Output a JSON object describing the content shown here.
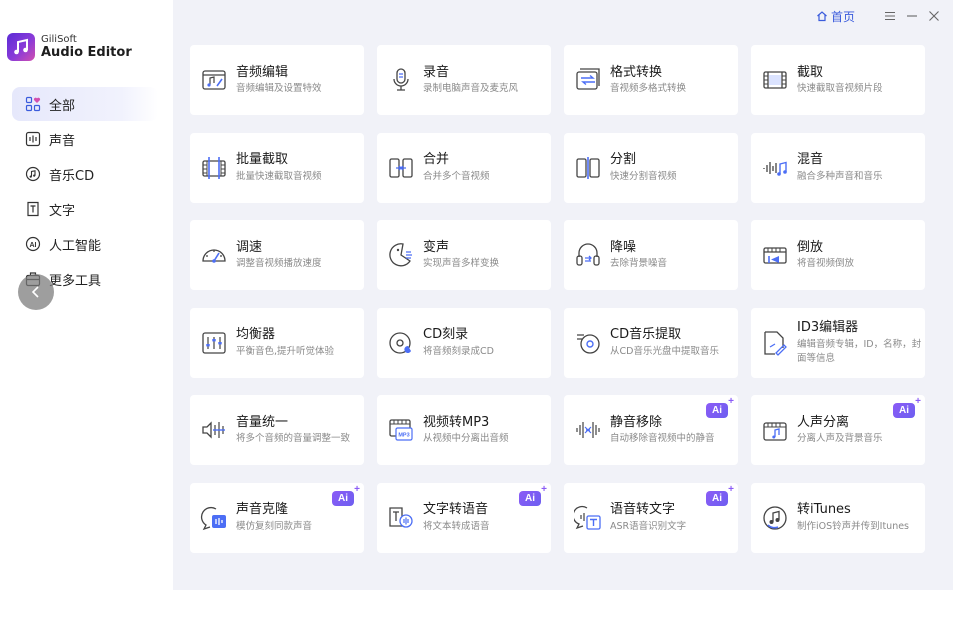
{
  "app": {
    "brand": "GiliSoft",
    "product": "Audio Editor"
  },
  "topbar": {
    "home_label": "首页"
  },
  "sidebar": {
    "items": [
      {
        "label": "全部",
        "icon": "grid-icon",
        "active": true
      },
      {
        "label": "声音",
        "icon": "sound-icon"
      },
      {
        "label": "音乐CD",
        "icon": "music-cd-icon"
      },
      {
        "label": "文字",
        "icon": "text-icon"
      },
      {
        "label": "人工智能",
        "icon": "ai-icon"
      },
      {
        "label": "更多工具",
        "icon": "toolbox-icon"
      }
    ]
  },
  "tools": [
    {
      "title": "音频编辑",
      "desc": "音频编辑及设置特效",
      "icon": "audio-edit-icon"
    },
    {
      "title": "录音",
      "desc": "录制电脑声音及麦克风",
      "icon": "microphone-icon"
    },
    {
      "title": "格式转换",
      "desc": "音视频多格式转换",
      "icon": "convert-icon"
    },
    {
      "title": "截取",
      "desc": "快速截取音视频片段",
      "icon": "trim-icon"
    },
    {
      "title": "批量截取",
      "desc": "批量快速截取音视频",
      "icon": "batch-trim-icon"
    },
    {
      "title": "合并",
      "desc": "合并多个音视频",
      "icon": "merge-icon"
    },
    {
      "title": "分割",
      "desc": "快速分割音视频",
      "icon": "split-icon"
    },
    {
      "title": "混音",
      "desc": "融合多种声音和音乐",
      "icon": "mix-icon"
    },
    {
      "title": "调速",
      "desc": "调整音视频播放速度",
      "icon": "speed-icon"
    },
    {
      "title": "变声",
      "desc": "实现声音多样变换",
      "icon": "voice-changer-icon"
    },
    {
      "title": "降噪",
      "desc": "去除背景噪音",
      "icon": "noise-reduction-icon"
    },
    {
      "title": "倒放",
      "desc": "将音视频倒放",
      "icon": "reverse-icon"
    },
    {
      "title": "均衡器",
      "desc": "平衡音色,提升听觉体验",
      "icon": "equalizer-icon"
    },
    {
      "title": "CD刻录",
      "desc": "将音频刻录成CD",
      "icon": "cd-burn-icon"
    },
    {
      "title": "CD音乐提取",
      "desc": "从CD音乐光盘中提取音乐",
      "icon": "cd-rip-icon"
    },
    {
      "title": "ID3编辑器",
      "desc": "编辑音频专辑，ID，名称，封面等信息",
      "icon": "id3-icon",
      "wrap": true
    },
    {
      "title": "音量统一",
      "desc": "将多个音频的音量调整一致",
      "icon": "volume-normalize-icon"
    },
    {
      "title": "视频转MP3",
      "desc": "从视频中分离出音频",
      "icon": "video-to-mp3-icon"
    },
    {
      "title": "静音移除",
      "desc": "自动移除音视频中的静音",
      "icon": "silence-remove-icon",
      "ai": true
    },
    {
      "title": "人声分离",
      "desc": "分离人声及背景音乐",
      "icon": "vocal-separation-icon",
      "ai": true
    },
    {
      "title": "声音克隆",
      "desc": "模仿复刻同款声音",
      "icon": "voice-clone-icon",
      "ai": true
    },
    {
      "title": "文字转语音",
      "desc": "将文本转成语音",
      "icon": "text-to-speech-icon",
      "ai": true
    },
    {
      "title": "语音转文字",
      "desc": "ASR语音识别文字",
      "icon": "speech-to-text-icon",
      "ai": true
    },
    {
      "title": "转iTunes",
      "desc": "制作iOS铃声并传到Itunes",
      "icon": "itunes-icon"
    }
  ],
  "ai_badge_label": "Ai",
  "colors": {
    "accent": "#3a5bdc",
    "nav_active": "#e6e8fb",
    "main_bg": "#f1f2f8",
    "ai_badge": "#8b5cf6"
  }
}
